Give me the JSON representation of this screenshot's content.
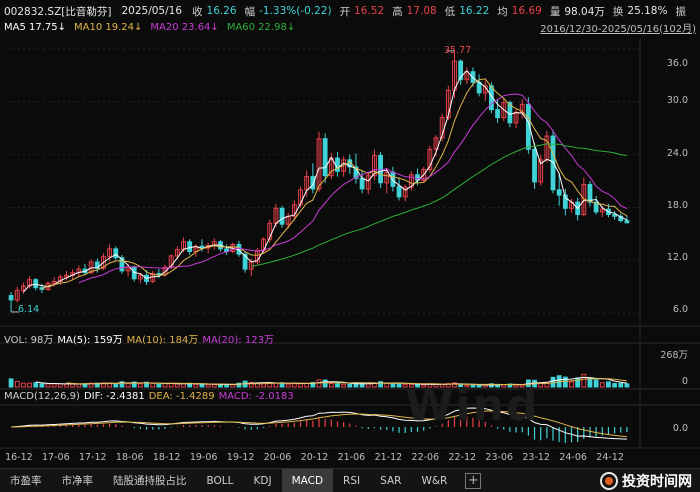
{
  "header": {
    "code": "002832.SZ[比音勒芬]",
    "date": "2025/05/16",
    "close_label": "收",
    "close": "16.26",
    "change_label": "幅",
    "change": "-1.33%(-0.22)",
    "open_label": "开",
    "open": "16.52",
    "high_label": "高",
    "high": "17.08",
    "low_label": "低",
    "low": "16.22",
    "avg_label": "均",
    "avg": "16.69",
    "vol_label": "量",
    "volume": "98.04万",
    "turnover_label": "换",
    "turnover": "25.18%",
    "amp_label": "振"
  },
  "ma_line": {
    "ma5": "MA5 17.75↓",
    "ma10": "MA10 19.24↓",
    "ma20": "MA20 23.64↓",
    "ma60": "MA60 22.98↓",
    "range": "2016/12/30-2025/05/16(102月)"
  },
  "price_panel": {
    "y_ticks": [
      "36.0",
      "30.0",
      "24.0",
      "18.0",
      "12.0",
      "6.0"
    ],
    "max_label": "35.77",
    "min_label": "6.14"
  },
  "vol_panel": {
    "label": "VOL: 98万",
    "ma5": "MA(5): 159万",
    "ma10": "MA(10): 184万",
    "ma20": "MA(20): 123万",
    "y_tick_top": "268万",
    "y_tick_bottom": "0"
  },
  "macd_panel": {
    "label": "MACD(12,26,9)",
    "dif": "DIF: -2.4381",
    "dea": "DEA: -1.4289",
    "macd": "MACD: -2.0183",
    "y_tick": "0.0"
  },
  "x_axis": [
    "16-12",
    "17-06",
    "17-12",
    "18-06",
    "18-12",
    "19-06",
    "19-12",
    "20-06",
    "20-12",
    "21-06",
    "21-12",
    "22-06",
    "22-12",
    "23-06",
    "23-12",
    "24-06",
    "24-12"
  ],
  "tabs": [
    "市盈率",
    "市净率",
    "陆股通持股占比",
    "BOLL",
    "KDJ",
    "MACD",
    "RSI",
    "SAR",
    "W&R"
  ],
  "brand": "投资时间网",
  "watermark": "Wind",
  "colors": {
    "up": "#e8414a",
    "down": "#3fd2d6",
    "ma5": "#ffffff",
    "ma10": "#e0b64a",
    "ma20": "#c93bd8",
    "ma60": "#2fae3a"
  },
  "chart_data": {
    "type": "candlestick",
    "title": "002832.SZ[比音勒芬]",
    "x": [
      "2016-12",
      "2017-01",
      "2017-02",
      "2017-03",
      "2017-04",
      "2017-05",
      "2017-06",
      "2017-07",
      "2017-08",
      "2017-09",
      "2017-10",
      "2017-11",
      "2017-12",
      "2018-01",
      "2018-02",
      "2018-03",
      "2018-04",
      "2018-05",
      "2018-06",
      "2018-07",
      "2018-08",
      "2018-09",
      "2018-10",
      "2018-11",
      "2018-12",
      "2019-01",
      "2019-02",
      "2019-03",
      "2019-04",
      "2019-05",
      "2019-06",
      "2019-07",
      "2019-08",
      "2019-09",
      "2019-10",
      "2019-11",
      "2019-12",
      "2020-01",
      "2020-02",
      "2020-03",
      "2020-04",
      "2020-05",
      "2020-06",
      "2020-07",
      "2020-08",
      "2020-09",
      "2020-10",
      "2020-11",
      "2020-12",
      "2021-01",
      "2021-02",
      "2021-03",
      "2021-04",
      "2021-05",
      "2021-06",
      "2021-07",
      "2021-08",
      "2021-09",
      "2021-10",
      "2021-11",
      "2021-12",
      "2022-01",
      "2022-02",
      "2022-03",
      "2022-04",
      "2022-05",
      "2022-06",
      "2022-07",
      "2022-08",
      "2022-09",
      "2022-10",
      "2022-11",
      "2022-12",
      "2023-01",
      "2023-02",
      "2023-03",
      "2023-04",
      "2023-05",
      "2023-06",
      "2023-07",
      "2023-08",
      "2023-09",
      "2023-10",
      "2023-11",
      "2023-12",
      "2024-01",
      "2024-02",
      "2024-03",
      "2024-04",
      "2024-05",
      "2024-06",
      "2024-07",
      "2024-08",
      "2024-09",
      "2024-10",
      "2024-11",
      "2024-12",
      "2025-01",
      "2025-02",
      "2025-03",
      "2025-04",
      "2025-05"
    ],
    "ohlc": [
      [
        8.0,
        8.4,
        6.14,
        7.5
      ],
      [
        7.5,
        9.0,
        7.2,
        8.6
      ],
      [
        8.6,
        9.5,
        8.2,
        9.1
      ],
      [
        9.1,
        10.2,
        8.8,
        9.8
      ],
      [
        9.8,
        10.0,
        8.6,
        8.9
      ],
      [
        8.9,
        9.3,
        8.3,
        8.7
      ],
      [
        8.7,
        9.6,
        8.5,
        9.4
      ],
      [
        9.4,
        10.1,
        9.0,
        9.6
      ],
      [
        9.6,
        10.4,
        9.2,
        10.1
      ],
      [
        10.1,
        10.8,
        9.7,
        10.3
      ],
      [
        10.3,
        11.0,
        9.8,
        10.6
      ],
      [
        10.6,
        11.4,
        10.2,
        11.0
      ],
      [
        11.0,
        11.6,
        10.3,
        10.6
      ],
      [
        10.6,
        12.1,
        10.4,
        11.8
      ],
      [
        11.8,
        12.2,
        10.6,
        11.1
      ],
      [
        11.1,
        12.8,
        10.9,
        12.4
      ],
      [
        12.4,
        13.8,
        11.9,
        13.3
      ],
      [
        13.3,
        13.6,
        12.0,
        12.3
      ],
      [
        12.3,
        12.6,
        10.5,
        10.8
      ],
      [
        10.8,
        11.6,
        10.2,
        11.2
      ],
      [
        11.2,
        11.4,
        9.6,
        9.9
      ],
      [
        9.9,
        10.6,
        9.4,
        10.3
      ],
      [
        10.3,
        10.9,
        9.2,
        9.6
      ],
      [
        9.6,
        10.8,
        9.4,
        10.5
      ],
      [
        10.5,
        11.0,
        10.0,
        10.4
      ],
      [
        10.4,
        11.5,
        10.1,
        11.2
      ],
      [
        11.2,
        12.7,
        11.0,
        12.5
      ],
      [
        12.5,
        13.6,
        12.1,
        13.2
      ],
      [
        13.2,
        14.6,
        12.9,
        14.1
      ],
      [
        14.1,
        14.4,
        12.6,
        13.0
      ],
      [
        13.0,
        13.8,
        12.4,
        13.6
      ],
      [
        13.6,
        14.4,
        13.0,
        13.4
      ],
      [
        13.4,
        14.0,
        12.8,
        13.7
      ],
      [
        13.7,
        14.5,
        13.2,
        14.1
      ],
      [
        14.1,
        14.3,
        13.0,
        13.3
      ],
      [
        13.3,
        13.8,
        12.6,
        13.0
      ],
      [
        13.0,
        14.0,
        12.8,
        13.8
      ],
      [
        13.8,
        14.2,
        12.4,
        12.7
      ],
      [
        12.7,
        13.0,
        10.6,
        11.0
      ],
      [
        11.0,
        12.2,
        10.2,
        11.8
      ],
      [
        11.8,
        13.4,
        11.5,
        13.1
      ],
      [
        13.1,
        14.6,
        12.9,
        14.4
      ],
      [
        14.4,
        16.6,
        14.0,
        16.2
      ],
      [
        16.2,
        18.4,
        15.8,
        17.9
      ],
      [
        17.9,
        18.2,
        15.7,
        16.1
      ],
      [
        16.1,
        17.4,
        15.6,
        17.0
      ],
      [
        17.0,
        18.8,
        16.5,
        18.3
      ],
      [
        18.3,
        20.4,
        18.0,
        20.0
      ],
      [
        20.0,
        22.2,
        19.2,
        21.5
      ],
      [
        21.5,
        23.0,
        19.6,
        20.1
      ],
      [
        20.1,
        26.6,
        19.8,
        25.8
      ],
      [
        25.8,
        26.4,
        20.8,
        21.6
      ],
      [
        21.6,
        24.2,
        21.2,
        23.6
      ],
      [
        23.6,
        24.3,
        21.5,
        22.1
      ],
      [
        22.1,
        23.8,
        21.5,
        23.4
      ],
      [
        23.4,
        24.0,
        21.8,
        22.6
      ],
      [
        22.6,
        24.1,
        20.7,
        21.3
      ],
      [
        21.3,
        22.2,
        19.6,
        20.1
      ],
      [
        20.1,
        22.0,
        19.5,
        21.6
      ],
      [
        21.6,
        24.6,
        21.1,
        23.9
      ],
      [
        23.9,
        24.3,
        20.2,
        20.8
      ],
      [
        20.8,
        22.5,
        19.6,
        22.0
      ],
      [
        22.0,
        22.6,
        19.8,
        20.4
      ],
      [
        20.4,
        21.4,
        18.8,
        19.2
      ],
      [
        19.2,
        20.6,
        18.7,
        20.3
      ],
      [
        20.3,
        22.1,
        19.9,
        21.7
      ],
      [
        21.7,
        22.4,
        20.5,
        21.1
      ],
      [
        21.1,
        22.6,
        20.9,
        22.3
      ],
      [
        22.3,
        25.0,
        22.0,
        24.6
      ],
      [
        24.6,
        26.2,
        23.8,
        25.9
      ],
      [
        25.9,
        28.6,
        25.5,
        28.2
      ],
      [
        28.2,
        31.8,
        27.9,
        31.3
      ],
      [
        31.3,
        35.77,
        30.4,
        34.6
      ],
      [
        34.6,
        34.8,
        31.9,
        32.5
      ],
      [
        32.5,
        33.9,
        32.0,
        33.4
      ],
      [
        33.4,
        33.9,
        31.7,
        32.2
      ],
      [
        32.2,
        33.1,
        30.6,
        31.0
      ],
      [
        31.0,
        32.4,
        30.1,
        31.8
      ],
      [
        31.8,
        32.2,
        28.7,
        29.1
      ],
      [
        29.1,
        30.2,
        27.6,
        28.2
      ],
      [
        28.2,
        30.4,
        27.8,
        29.9
      ],
      [
        29.9,
        30.1,
        27.1,
        27.6
      ],
      [
        27.6,
        29.2,
        27.0,
        28.8
      ],
      [
        28.8,
        30.3,
        28.1,
        29.7
      ],
      [
        29.7,
        30.5,
        24.1,
        24.6
      ],
      [
        24.6,
        25.3,
        20.1,
        20.9
      ],
      [
        20.9,
        24.0,
        20.5,
        23.4
      ],
      [
        23.4,
        26.7,
        23.1,
        26.1
      ],
      [
        26.1,
        26.8,
        19.6,
        20.0
      ],
      [
        20.0,
        21.9,
        18.2,
        19.4
      ],
      [
        19.4,
        20.1,
        17.1,
        17.9
      ],
      [
        17.9,
        19.0,
        17.4,
        18.6
      ],
      [
        18.6,
        19.1,
        16.5,
        17.2
      ],
      [
        17.2,
        21.4,
        17.0,
        20.6
      ],
      [
        20.6,
        21.0,
        18.1,
        18.6
      ],
      [
        18.6,
        19.3,
        17.2,
        17.5
      ],
      [
        17.5,
        18.2,
        16.9,
        17.8
      ],
      [
        17.8,
        18.4,
        16.9,
        17.2
      ],
      [
        17.2,
        17.6,
        16.6,
        17.0
      ],
      [
        17.0,
        17.3,
        16.3,
        16.5
      ],
      [
        16.5,
        17.08,
        16.22,
        16.26
      ]
    ],
    "ylim": [
      5,
      37
    ],
    "max_marker": 35.77,
    "min_marker": 6.14
  }
}
